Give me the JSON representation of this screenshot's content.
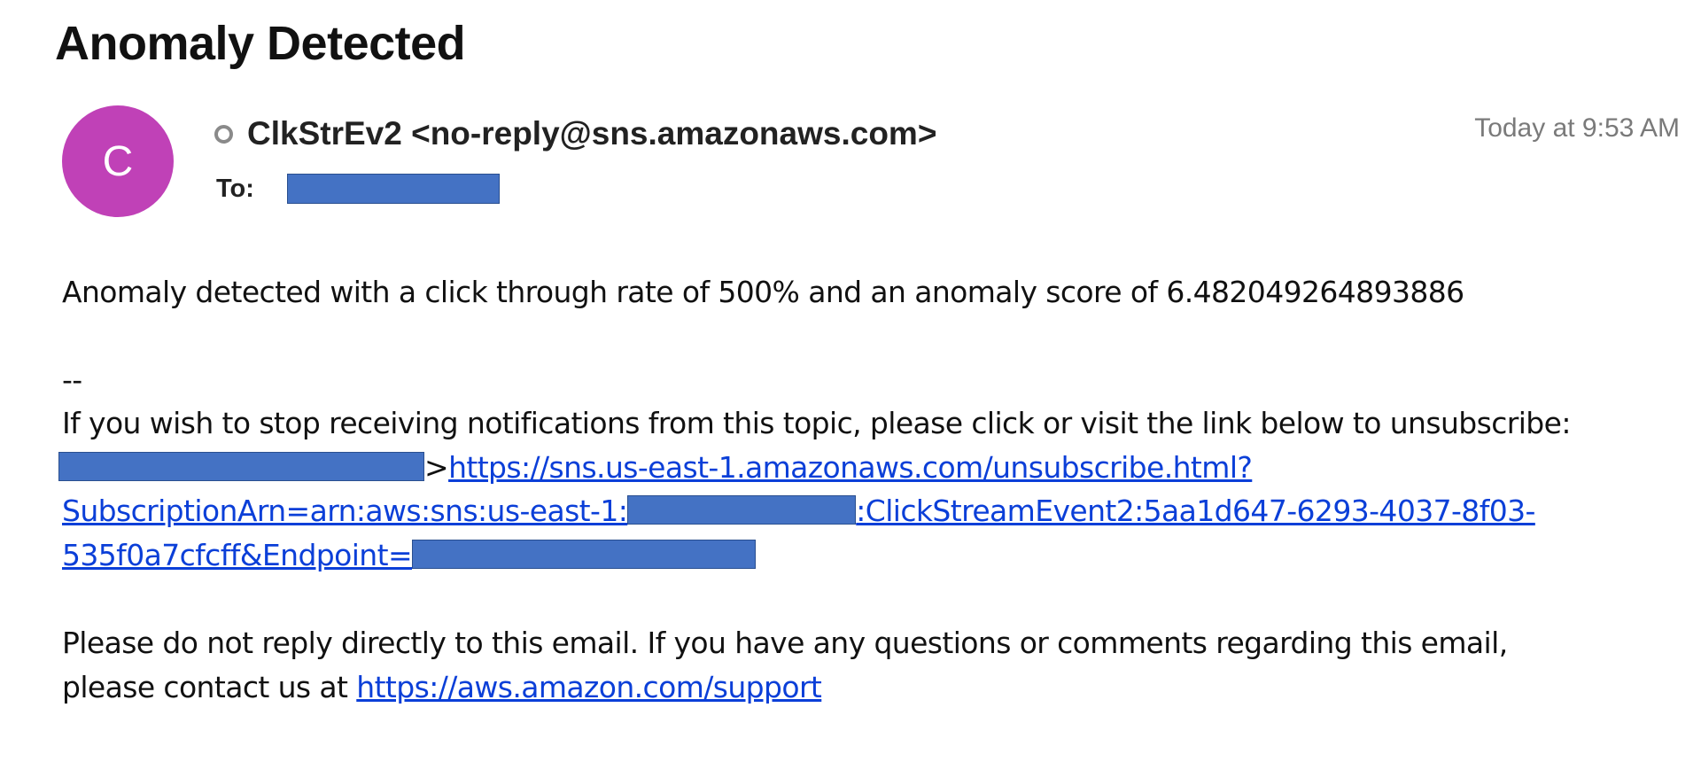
{
  "email": {
    "subject": "Anomaly Detected",
    "avatar_letter": "C",
    "avatar_color": "#c041b7",
    "sender": "ClkStrEv2 <no-reply@sns.amazonaws.com>",
    "to_label": "To:",
    "timestamp": "Today at 9:53 AM",
    "redaction_color": "#4472c4",
    "link_color": "#0b3fd8",
    "body": {
      "message": "Anomaly detected with a click through rate of 500% and an anomaly score of 6.482049264893886",
      "separator": "--",
      "unsubscribe_intro": "If you wish to stop receiving notifications from this topic, please click or visit the link below to unsubscribe:",
      "angle_bracket": ">",
      "unsubscribe_link_part1": "https://sns.us-east-1.amazonaws.com/unsubscribe.html?",
      "unsubscribe_link_part2": "SubscriptionArn=arn:aws:sns:us-east-1:",
      "unsubscribe_link_part3": ":ClickStreamEvent2:5aa1d647-6293-4037-8f03-",
      "unsubscribe_link_part4": "535f0a7cfcff&Endpoint=",
      "footer_line1": "Please do not reply directly to this email. If you have any questions or comments regarding this email,",
      "footer_line2_prefix": "please contact us at ",
      "support_link": "https://aws.amazon.com/support"
    }
  }
}
